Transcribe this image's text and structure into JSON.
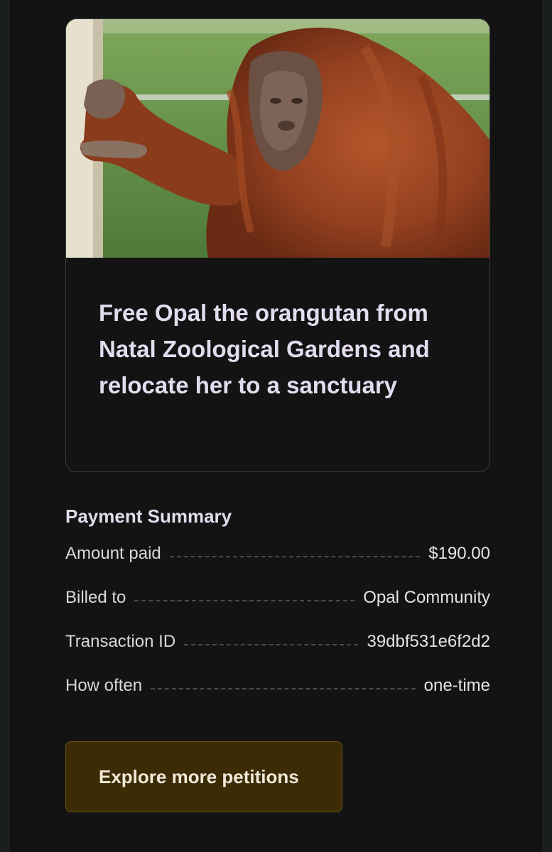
{
  "petition": {
    "title": "Free Opal the orangutan from Natal Zoological Gardens and relocate her to a sanctuary"
  },
  "summary": {
    "heading": "Payment Summary",
    "rows": [
      {
        "label": "Amount paid",
        "value": "$190.00"
      },
      {
        "label": "Billed to",
        "value": "Opal Community"
      },
      {
        "label": "Transaction ID",
        "value": "39dbf531e6f2d2"
      },
      {
        "label": "How often",
        "value": "one-time"
      }
    ]
  },
  "actions": {
    "explore_label": "Explore more petitions"
  },
  "colors": {
    "page_bg": "#131313",
    "title_text": "#e3dcef",
    "button_bg": "#3c2c06",
    "button_border": "#6b5410"
  }
}
